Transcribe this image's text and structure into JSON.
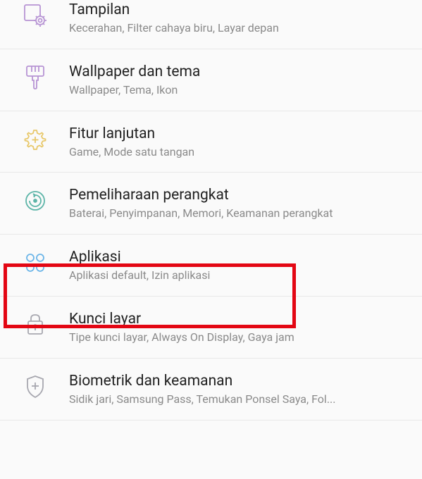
{
  "settings": {
    "items": [
      {
        "title": "Tampilan",
        "subtitle": "Kecerahan, Filter cahaya biru, Layar depan"
      },
      {
        "title": "Wallpaper dan tema",
        "subtitle": "Wallpaper, Tema, Ikon"
      },
      {
        "title": "Fitur lanjutan",
        "subtitle": "Game, Mode satu tangan"
      },
      {
        "title": "Pemeliharaan perangkat",
        "subtitle": "Baterai, Penyimpanan, Memori, Keamanan perangkat"
      },
      {
        "title": "Aplikasi",
        "subtitle": "Aplikasi default, Izin aplikasi"
      },
      {
        "title": "Kunci layar",
        "subtitle": "Tipe kunci layar, Always On Display, Gaya jam"
      },
      {
        "title": "Biometrik dan keamanan",
        "subtitle": "Sidik jari, Samsung Pass, Temukan Ponsel Saya, Fol..."
      }
    ]
  },
  "colors": {
    "highlight": "#e30613",
    "iconPurple": "#b794d4",
    "iconYellow": "#e8c86a",
    "iconTeal": "#5db5a8",
    "iconBlue": "#6bb5e8",
    "iconGray": "#a8a8b0"
  }
}
